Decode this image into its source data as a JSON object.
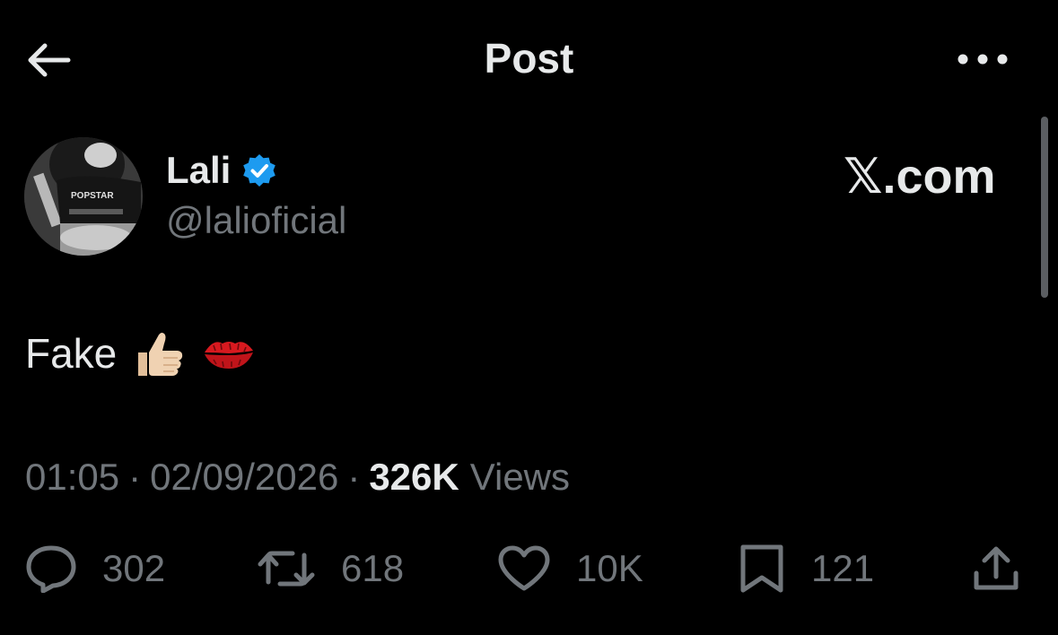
{
  "header": {
    "title": "Post"
  },
  "author": {
    "name": "Lali",
    "handle": "@lalioficial",
    "verified": true,
    "avatar_shirt_text": "POPSTAR"
  },
  "watermark": "𝕏.com",
  "post": {
    "text": "Fake",
    "emojis": [
      "thumbs-up-icon",
      "kiss-mark-icon"
    ]
  },
  "meta": {
    "time": "01:05",
    "date": "02/09/2026",
    "views_count": "326K",
    "views_label": "Views",
    "separator": "·"
  },
  "actions": {
    "replies": "302",
    "reposts": "618",
    "likes": "10K",
    "bookmarks": "121"
  },
  "colors": {
    "background": "#000000",
    "text": "#e7e9ea",
    "secondary": "#71767b",
    "verified": "#1d9bf0"
  }
}
